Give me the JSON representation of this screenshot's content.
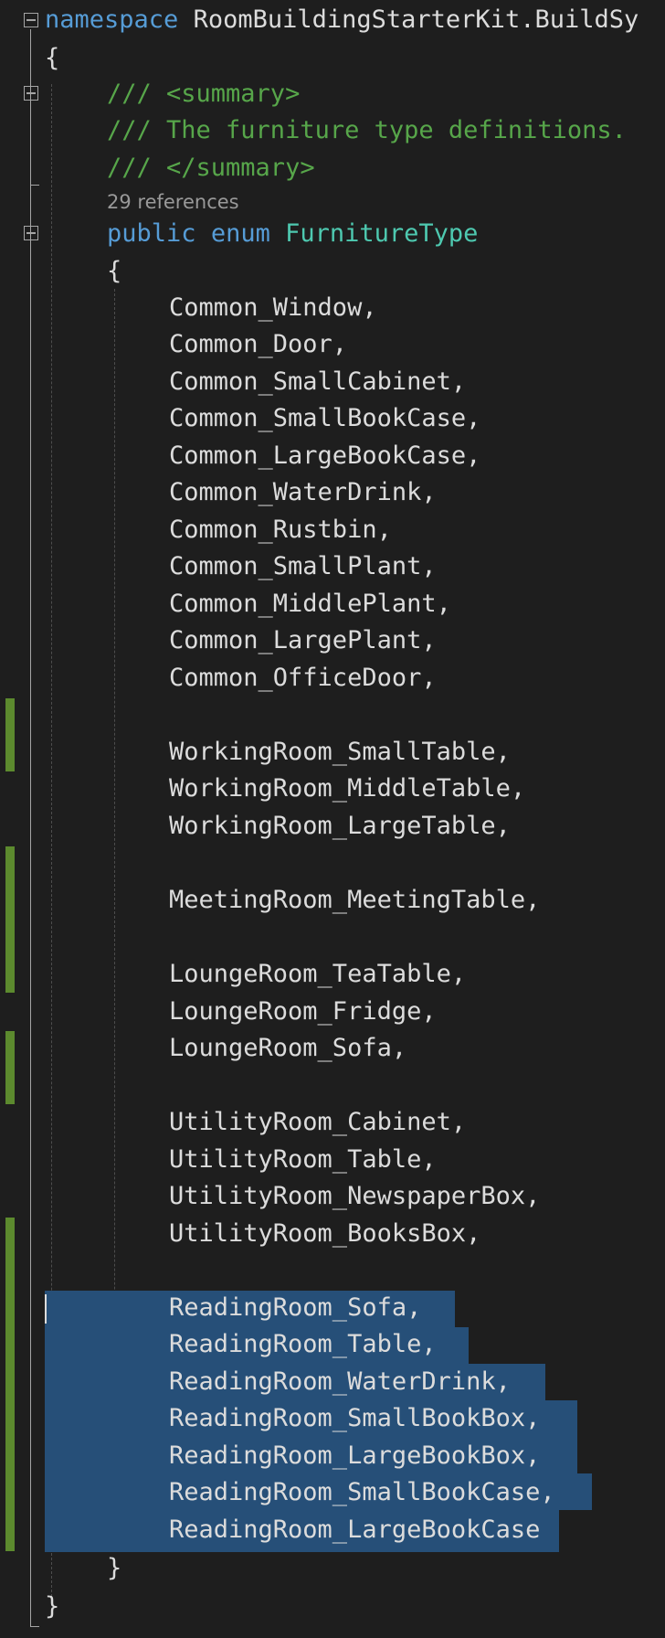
{
  "editor": {
    "lines": {
      "namespace": {
        "keyword": "namespace",
        "name": "RoomBuildingStarterKit.BuildSy"
      },
      "ns_open": "{",
      "summary_open": "/// <summary>",
      "summary_text": "/// The furniture type definitions.",
      "summary_close": "/// </summary>",
      "codelens": "29 references",
      "enum_decl": {
        "public": "public",
        "enum": "enum",
        "name": "FurnitureType"
      },
      "enum_open": "{",
      "members": [
        "Common_Window,",
        "Common_Door,",
        "Common_SmallCabinet,",
        "Common_SmallBookCase,",
        "Common_LargeBookCase,",
        "Common_WaterDrink,",
        "Common_Rustbin,",
        "Common_SmallPlant,",
        "Common_MiddlePlant,",
        "Common_LargePlant,",
        "Common_OfficeDoor,",
        "WorkingRoom_SmallTable,",
        "WorkingRoom_MiddleTable,",
        "WorkingRoom_LargeTable,",
        "MeetingRoom_MeetingTable,",
        "LoungeRoom_TeaTable,",
        "LoungeRoom_Fridge,",
        "LoungeRoom_Sofa,",
        "UtilityRoom_Cabinet,",
        "UtilityRoom_Table,",
        "UtilityRoom_NewspaperBox,",
        "UtilityRoom_BooksBox,",
        "ReadingRoom_Sofa,",
        "ReadingRoom_Table,",
        "ReadingRoom_WaterDrink,",
        "ReadingRoom_SmallBookBox,",
        "ReadingRoom_LargeBookBox,",
        "ReadingRoom_SmallBookCase,",
        "ReadingRoom_LargeBookCase"
      ],
      "enum_close": "}",
      "ns_close": "}"
    },
    "colors": {
      "background": "#1e1e1e",
      "keyword": "#569cd6",
      "type": "#4ec9b0",
      "comment": "#57a64a",
      "text": "#dcdcdc",
      "codelens": "#999999",
      "selection": "#264f78",
      "change_bar": "#5c8a2e"
    },
    "icons": [
      "collapse-icon"
    ]
  }
}
